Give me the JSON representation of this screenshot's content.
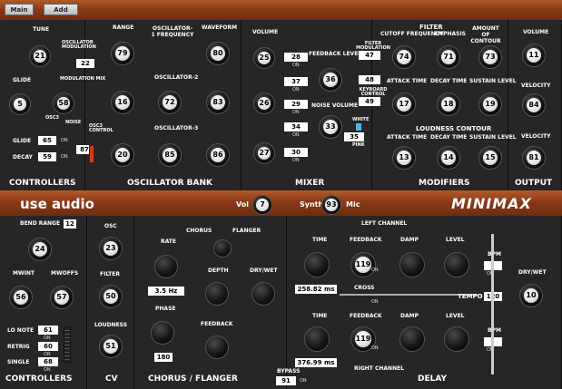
{
  "toolbar": {
    "main_label": "Main",
    "add_label": "Add"
  },
  "controllers": {
    "title": "CONTROLLERS",
    "tune_label": "TUNE",
    "tune": "21",
    "glide_label": "GLIDE",
    "glide": "5",
    "osc_mod_label": "OSCILLATOR MODULATION",
    "osc_mod": "22",
    "mod_mix_label": "MODULATION MIX",
    "mod_mix": "58",
    "osc3_label": "OSC3",
    "noise_label": "NOISE",
    "glide2_label": "GLIDE",
    "glide2": "65",
    "decay_label": "DECAY",
    "decay": "59",
    "osc3_control": "87"
  },
  "osc_bank": {
    "title": "OSCILLATOR BANK",
    "range_label": "RANGE",
    "freq_label": "OSCILLATOR-1 FREQUENCY",
    "waveform_label": "WAVEFORM",
    "osc2_label": "OSCILLATOR-2",
    "osc3_label": "OSCILLATOR-3",
    "osc3_ctrl_label": "OSC3 CONTROL",
    "range1": "79",
    "wave1": "80",
    "range2": "16",
    "freq2": "72",
    "wave2": "83",
    "range3": "20",
    "freq3": "85",
    "wave3": "86"
  },
  "mixer": {
    "title": "MIXER",
    "volume_label": "VOLUME",
    "feedback_label": "FEEDBACK LEVEL",
    "noise_label": "NOISE VOLUME",
    "white_label": "WHITE",
    "pink_label": "PINK",
    "v1": "25",
    "v1b": "28",
    "v2": "26",
    "v2b": "37",
    "v3": "27",
    "v3b": "29",
    "fb": "36",
    "nv": "33",
    "n1": "34",
    "n2": "30",
    "n3": "35"
  },
  "modifiers": {
    "title": "MODIFIERS",
    "filter_label": "FILTER",
    "cutoff_label": "CUTOFF FREQUENCY",
    "emphasis_label": "EMPHASIS",
    "amount_label": "AMOUNT OF CONTOUR",
    "filter_mod_label": "FILTER MODULATION",
    "kbd_label": "KEYBOARD CONTROL",
    "attack_label": "ATTACK TIME",
    "decay_label": "DECAY TIME",
    "sustain_label": "SUSTAIN LEVEL",
    "loudness_label": "LOUDNESS CONTOUR",
    "cutoff": "74",
    "emphasis": "71",
    "amount": "73",
    "fm": "47",
    "kc1": "48",
    "kc2": "49",
    "fa": "17",
    "fd": "18",
    "fs": "19",
    "la": "13",
    "ld": "14",
    "ls": "15"
  },
  "output": {
    "title": "OUTPUT",
    "volume_label": "VOLUME",
    "velocity_label": "VELOCITY",
    "vol": "11",
    "vel1": "84",
    "vel2": "81"
  },
  "brand": {
    "logo": "use audio",
    "vol_label": "Vol",
    "vol": "7",
    "synth_label": "Synth",
    "synth": "93",
    "mic_label": "Mic",
    "minimax": "MINIMAX"
  },
  "bottom_controllers": {
    "title": "CONTROLLERS",
    "bend_label": "BEND RANGE",
    "bend_value": "12",
    "bend": "24",
    "mwint_label": "MWINT",
    "mwoffs_label": "MWOFFS",
    "mwint": "56",
    "mwoffs": "57",
    "lonote_label": "LO NOTE",
    "lonote": "61",
    "retrig_label": "RETRIG",
    "retrig": "60",
    "single_label": "SINGLE",
    "single": "68"
  },
  "cv": {
    "title": "CV",
    "osc_label": "OSC",
    "osc": "23",
    "filter_label": "FILTER",
    "filter": "50",
    "loudness_label": "LOUDNESS",
    "loudness": "51"
  },
  "chorus": {
    "title": "CHORUS / FLANGER",
    "chorus_label": "CHORUS",
    "flanger_label": "FLANGER",
    "rate_label": "RATE",
    "rate_value": "3.5 Hz",
    "depth_label": "DEPTH",
    "drywet_label": "DRY/WET",
    "phase_label": "PHASE",
    "phase_value": "180",
    "feedback_label": "FEEDBACK",
    "bypass_label": "BYPASS",
    "bypass": "91"
  },
  "delay": {
    "title": "DELAY",
    "left_label": "LEFT CHANNEL",
    "right_label": "RIGHT CHANNEL",
    "time_label": "TIME",
    "feedback_label": "FEEDBACK",
    "damp_label": "DAMP",
    "level_label": "LEVEL",
    "fb_l": "119",
    "fb_r": "119",
    "time_l": "258.82 ms",
    "time_r": "376.99 ms",
    "cross_label": "CROSS",
    "tempo_label": "TEMPO",
    "tempo": "120",
    "bpm_label": "BPM",
    "drywet_label": "DRY/WET",
    "drywet": "10"
  },
  "on_label": "ON"
}
